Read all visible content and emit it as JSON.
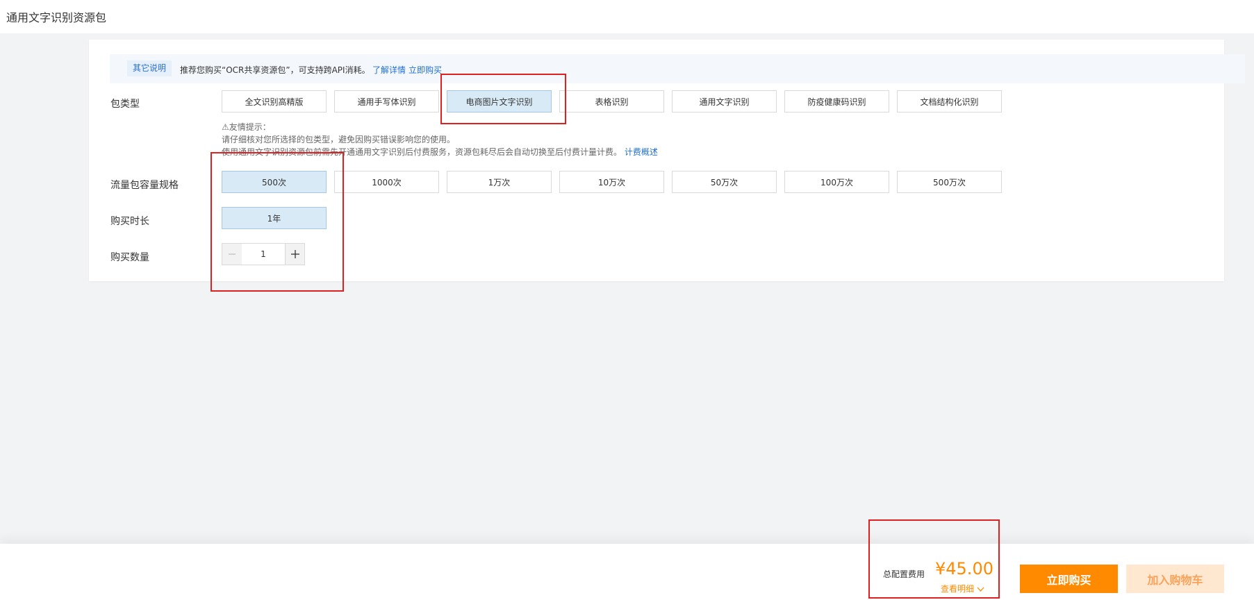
{
  "page": {
    "title": "通用文字识别资源包"
  },
  "notice": {
    "tag": "其它说明",
    "text": "推荐您购买“OCR共享资源包”，可支持跨API消耗。",
    "link_details": "了解详情",
    "link_buy": "立即购买"
  },
  "package_type": {
    "label": "包类型",
    "options": [
      "全文识别高精版",
      "通用手写体识别",
      "电商图片文字识别",
      "表格识别",
      "通用文字识别",
      "防疫健康码识别",
      "文档结构化识别"
    ],
    "selected": "电商图片文字识别",
    "tip_title": "⚠友情提示：",
    "tip_line1": "请仔细核对您所选择的包类型，避免因购买错误影响您的使用。",
    "tip_line2": "使用通用文字识别资源包前需先开通通用文字识别后付费服务，资源包耗尽后会自动切换至后付费计量计费。",
    "tip_link": "计费概述"
  },
  "capacity": {
    "label": "流量包容量规格",
    "options": [
      "500次",
      "1000次",
      "1万次",
      "10万次",
      "50万次",
      "100万次",
      "500万次"
    ],
    "selected": "500次"
  },
  "duration": {
    "label": "购买时长",
    "options": [
      "1年"
    ],
    "selected": "1年"
  },
  "quantity": {
    "label": "购买数量",
    "value": "1",
    "minus_icon": "minus-icon",
    "plus_icon": "plus-icon"
  },
  "footer": {
    "fee_label": "总配置费用",
    "fee_amount": "¥45.00",
    "detail_link": "查看明细",
    "buy_button": "立即购买",
    "cart_button": "加入购物车"
  },
  "colors": {
    "accent_orange": "#ff8a00",
    "link_blue": "#1f6fd6",
    "selected_bg": "#d9eaf7",
    "highlight_red": "#e02020"
  }
}
